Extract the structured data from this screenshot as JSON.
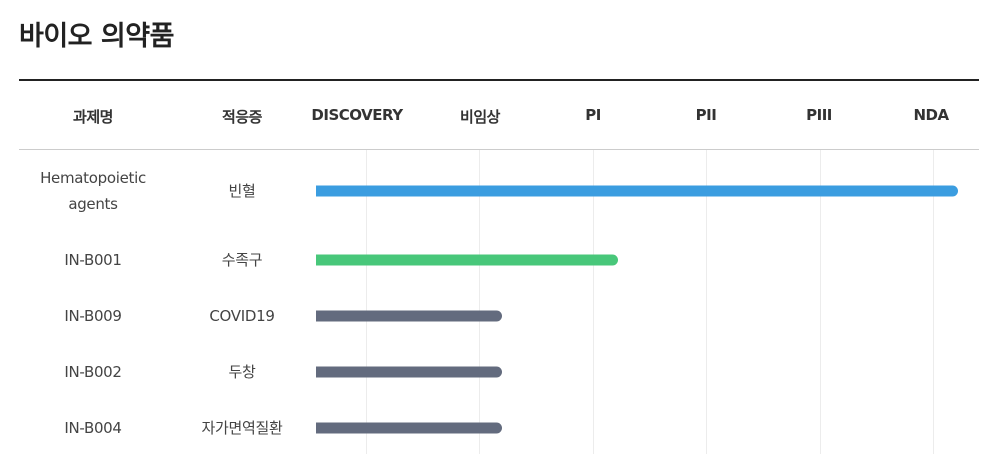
{
  "page": {
    "title": "바이오 의약품"
  },
  "table": {
    "headers": [
      "과제명",
      "적응증",
      "DISCOVERY",
      "비임상",
      "PI",
      "PII",
      "PIII",
      "NDA"
    ],
    "rows": [
      {
        "project": "Hematopoietic agents",
        "indication": "빈혈",
        "progress": 1.0,
        "color": "#3b9de0"
      },
      {
        "project": "IN-B001",
        "indication": "수족구",
        "progress": 0.47,
        "color": "#48c77a"
      },
      {
        "project": "IN-B009",
        "indication": "COVID19",
        "progress": 0.29,
        "color": "#636b7e"
      },
      {
        "project": "IN-B002",
        "indication": "두창",
        "progress": 0.29,
        "color": "#636b7e"
      },
      {
        "project": "IN-B004",
        "indication": "자가면역질환",
        "progress": 0.29,
        "color": "#636b7e"
      }
    ]
  }
}
